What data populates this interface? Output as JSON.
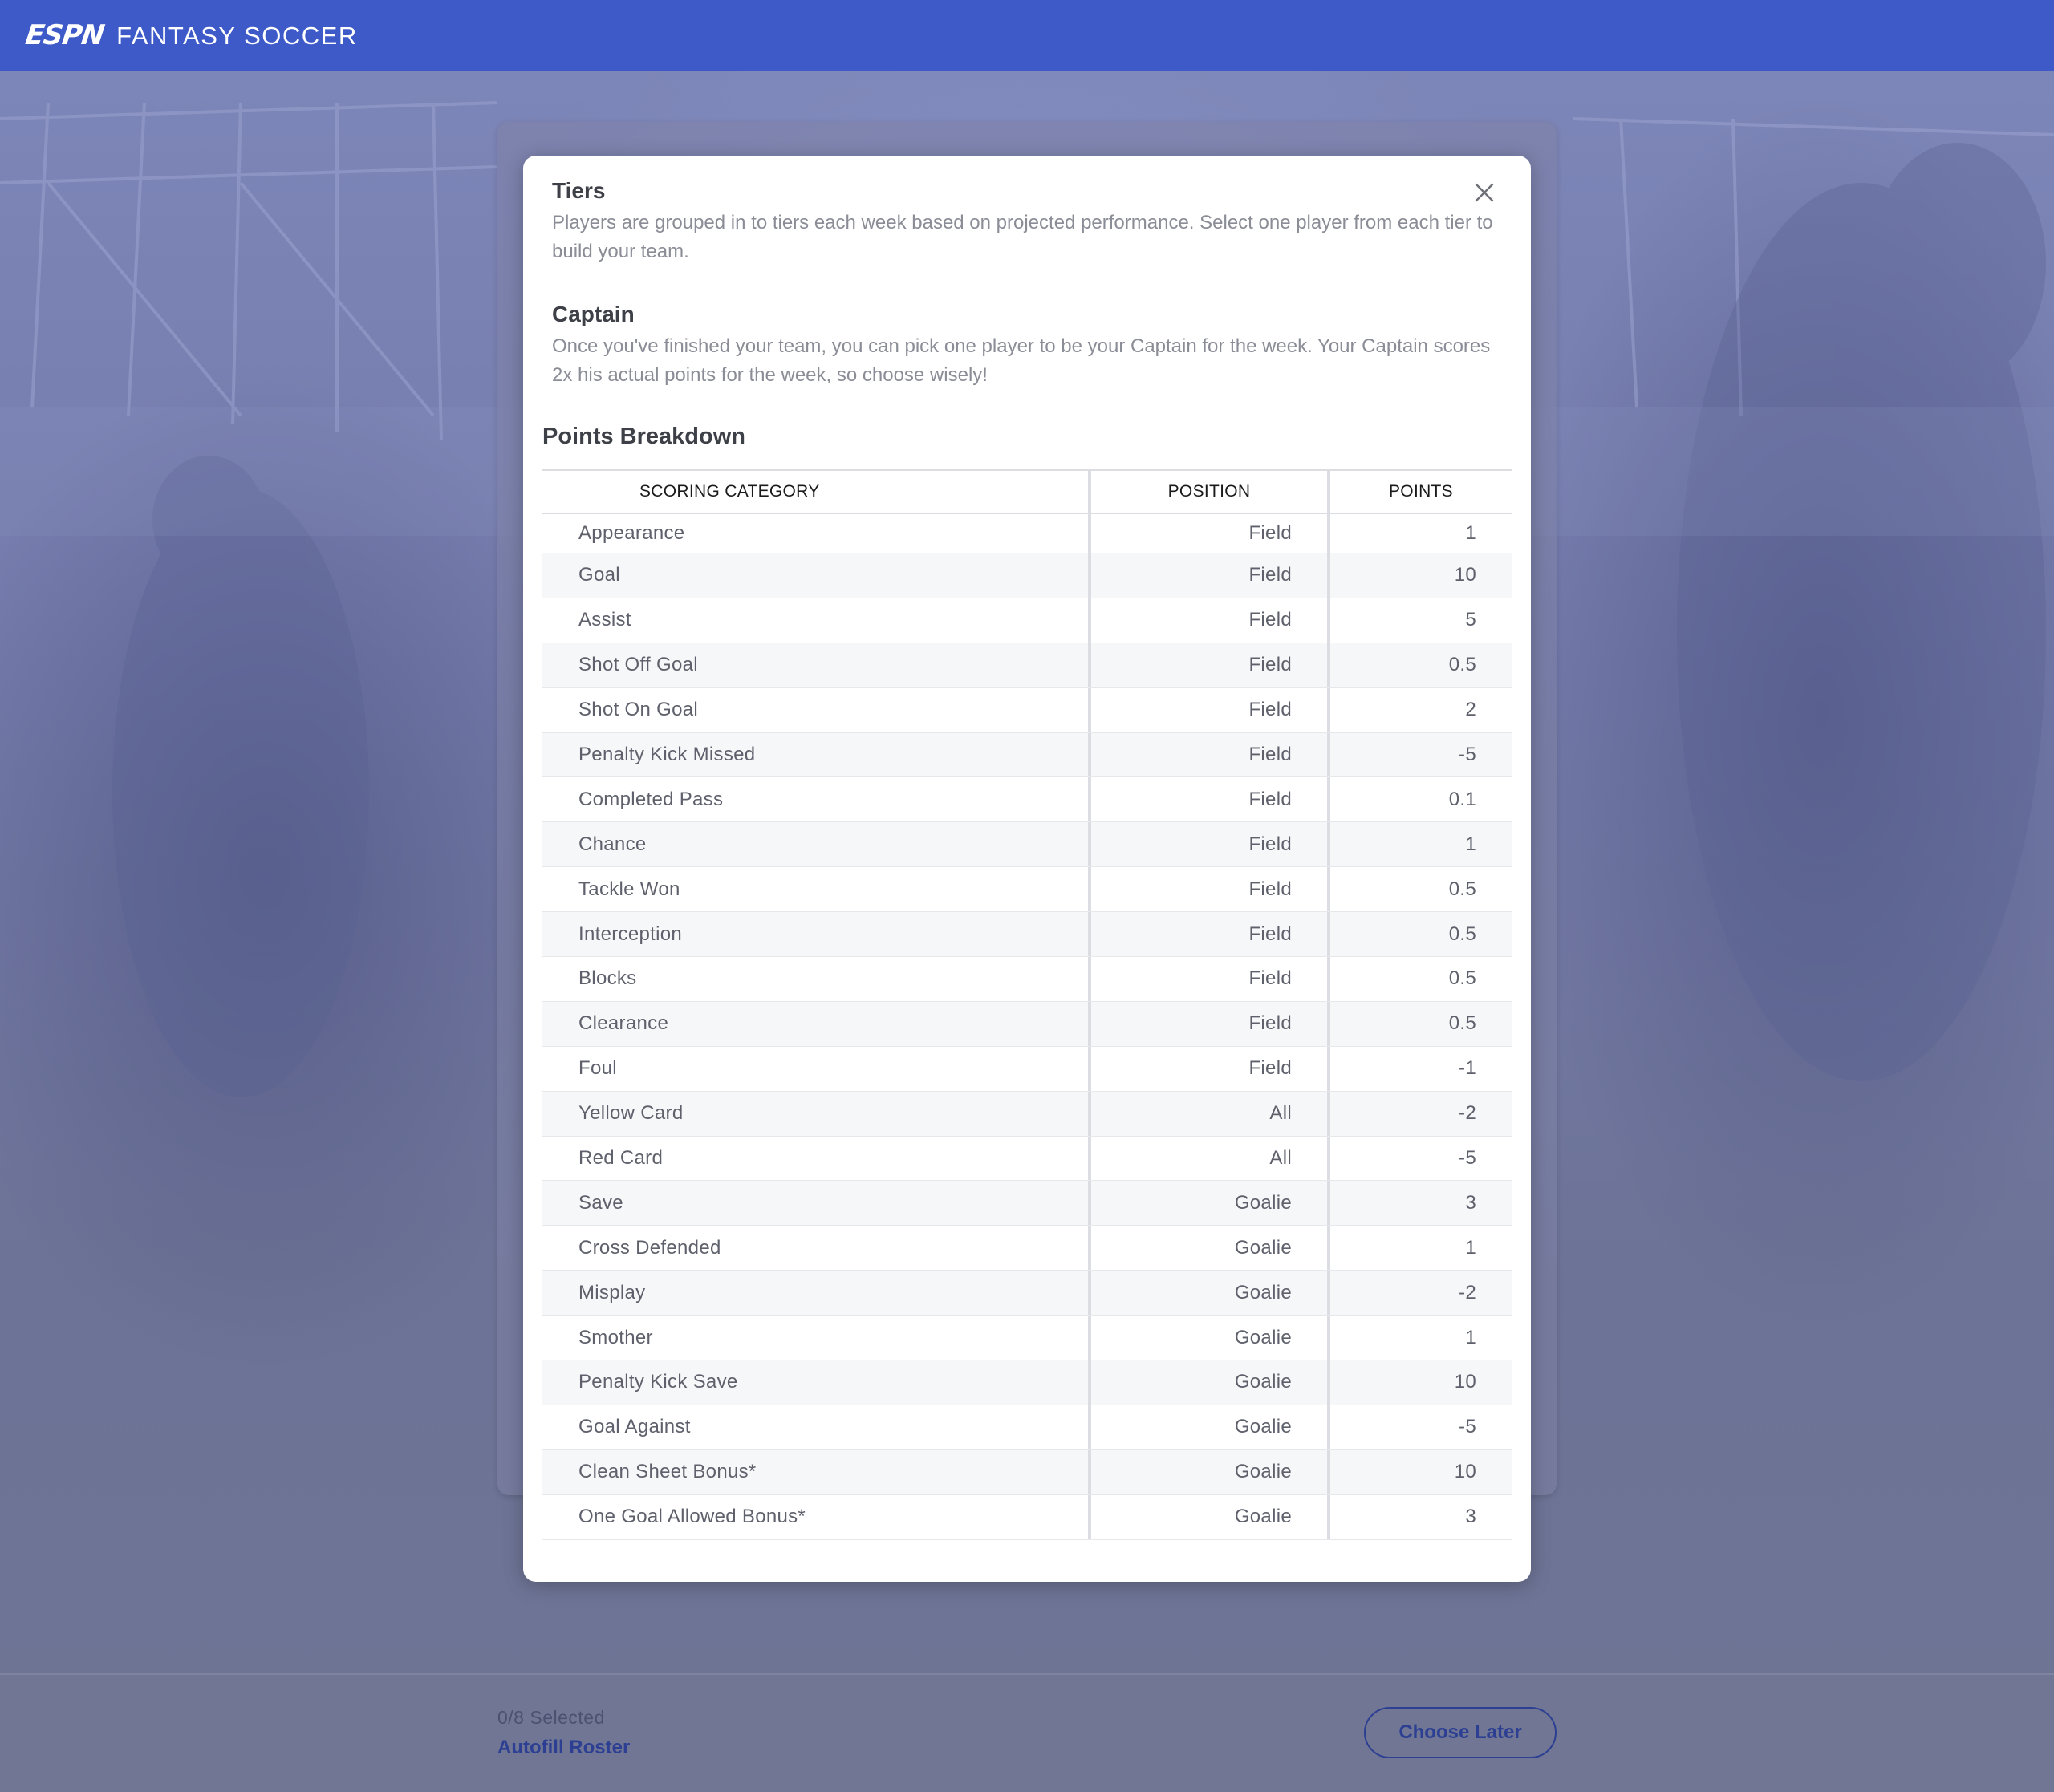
{
  "header": {
    "logo": "ESPN",
    "title": "FANTASY SOCCER"
  },
  "modal": {
    "tiers_title": "Tiers",
    "tiers_text": "Players are grouped in to tiers each week based on projected performance. Select one player from each tier to build your team.",
    "captain_title": "Captain",
    "captain_text": "Once you've finished your team, you can pick one player to be your Captain for the week. Your Captain scores 2x his actual points for the week, so choose wisely!",
    "points_title": "Points Breakdown",
    "close_icon": "close-icon"
  },
  "table": {
    "headers": {
      "category": "SCORING CATEGORY",
      "position": "POSITION",
      "points": "POINTS"
    },
    "rows": [
      {
        "category": "Appearance",
        "position": "Field",
        "points": "1"
      },
      {
        "category": "Goal",
        "position": "Field",
        "points": "10"
      },
      {
        "category": "Assist",
        "position": "Field",
        "points": "5"
      },
      {
        "category": "Shot Off Goal",
        "position": "Field",
        "points": "0.5"
      },
      {
        "category": "Shot On Goal",
        "position": "Field",
        "points": "2"
      },
      {
        "category": "Penalty Kick Missed",
        "position": "Field",
        "points": "-5"
      },
      {
        "category": "Completed Pass",
        "position": "Field",
        "points": "0.1"
      },
      {
        "category": "Chance",
        "position": "Field",
        "points": "1"
      },
      {
        "category": "Tackle Won",
        "position": "Field",
        "points": "0.5"
      },
      {
        "category": "Interception",
        "position": "Field",
        "points": "0.5"
      },
      {
        "category": "Blocks",
        "position": "Field",
        "points": "0.5"
      },
      {
        "category": "Clearance",
        "position": "Field",
        "points": "0.5"
      },
      {
        "category": "Foul",
        "position": "Field",
        "points": "-1"
      },
      {
        "category": "Yellow Card",
        "position": "All",
        "points": "-2"
      },
      {
        "category": "Red Card",
        "position": "All",
        "points": "-5"
      },
      {
        "category": "Save",
        "position": "Goalie",
        "points": "3"
      },
      {
        "category": "Cross Defended",
        "position": "Goalie",
        "points": "1"
      },
      {
        "category": "Misplay",
        "position": "Goalie",
        "points": "-2"
      },
      {
        "category": "Smother",
        "position": "Goalie",
        "points": "1"
      },
      {
        "category": "Penalty Kick Save",
        "position": "Goalie",
        "points": "10"
      },
      {
        "category": "Goal Against",
        "position": "Goalie",
        "points": "-5"
      },
      {
        "category": "Clean Sheet Bonus*",
        "position": "Goalie",
        "points": "10"
      },
      {
        "category": "One Goal Allowed Bonus*",
        "position": "Goalie",
        "points": "3"
      }
    ]
  },
  "footer": {
    "selected_count": "0/8 Selected",
    "autofill_label": "Autofill Roster",
    "choose_later_label": "Choose Later"
  },
  "colors": {
    "header_bg": "#3d5ac8",
    "accent": "#2c3f92",
    "overlay": "#6e7494"
  }
}
